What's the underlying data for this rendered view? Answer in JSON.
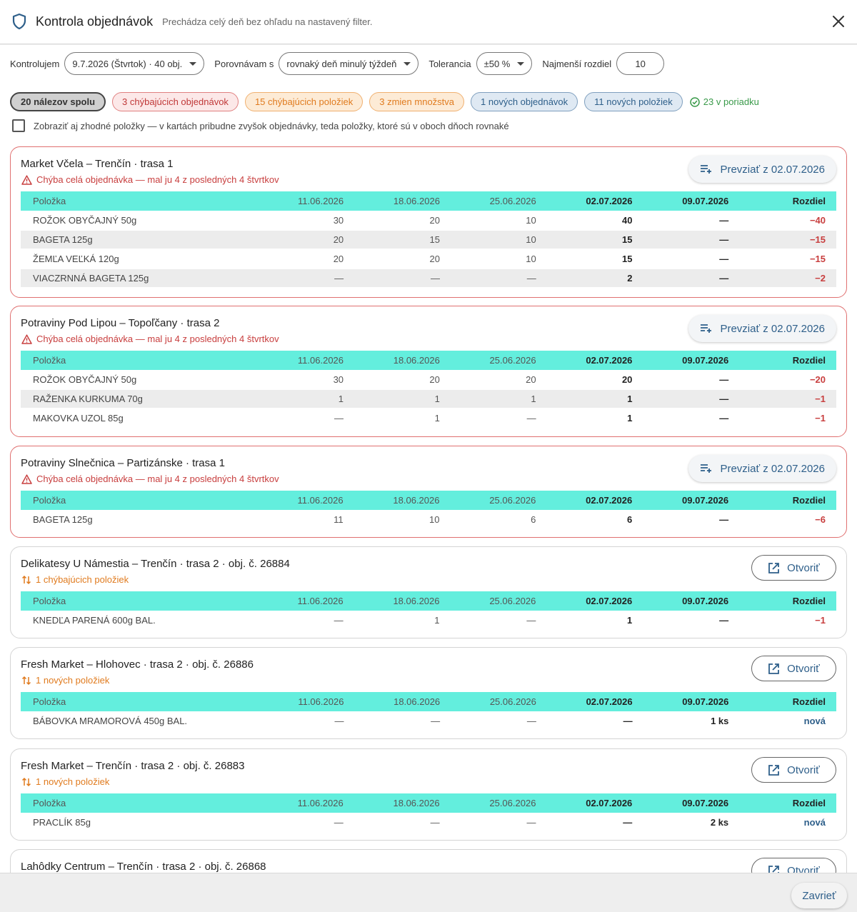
{
  "header": {
    "title": "Kontrola objednávok",
    "subtitle": "Prechádza celý deň bez ohľadu na nastavený filter."
  },
  "filters": {
    "check_label": "Kontrolujem",
    "check_value": "9.7.2026 (Štvrtok) · 40 obj.",
    "compare_label": "Porovnávam s",
    "compare_value": "rovnaký deň minulý týždeň",
    "tolerance_label": "Tolerancia",
    "tolerance_value": "±50 %",
    "min_diff_label": "Najmenší rozdiel",
    "min_diff_value": "10"
  },
  "chips": {
    "all": "20 nálezov spolu",
    "missing_orders": "3 chýbajúcich objednávok",
    "missing_items": "15 chýbajúcich položiek",
    "qty_changes": "3 zmien množstva",
    "new_orders": "1 nových objednávok",
    "new_items": "11 nových položiek",
    "ok": "23 v poriadku"
  },
  "show_matching_label": "Zobraziť aj zhodné položky — v kartách pribudne zvyšok objednávky, teda položky, ktoré sú v oboch dňoch rovnaké",
  "table_headers": [
    "Položka",
    "11.06.2026",
    "18.06.2026",
    "25.06.2026",
    "02.07.2026",
    "09.07.2026",
    "Rozdiel"
  ],
  "cards": [
    {
      "name": "Market Včela – Trenčín · trasa 1",
      "note": "Chýba celá objednávka — mal ju 4 z posledných 4 štvrtkov",
      "action": "Prevziať z 02.07.2026",
      "rows": [
        [
          "ROŽOK OBYČAJNÝ 50g",
          "30",
          "20",
          "10",
          "40",
          "—",
          "−40"
        ],
        [
          "BAGETA 125g",
          "20",
          "15",
          "10",
          "15",
          "—",
          "−15"
        ],
        [
          "ŽEMĽA VEĽKÁ 120g",
          "20",
          "20",
          "10",
          "15",
          "—",
          "−15"
        ],
        [
          "VIACZRNNÁ BAGETA 125g",
          "—",
          "—",
          "—",
          "2",
          "—",
          "−2"
        ]
      ]
    },
    {
      "name": "Potraviny Pod Lipou – Topoľčany · trasa 2",
      "note": "Chýba celá objednávka — mal ju 4 z posledných 4 štvrtkov",
      "action": "Prevziať z 02.07.2026",
      "rows": [
        [
          "ROŽOK OBYČAJNÝ 50g",
          "30",
          "20",
          "20",
          "20",
          "—",
          "−20"
        ],
        [
          "RAŽENKA KURKUMA 70g",
          "1",
          "1",
          "1",
          "1",
          "—",
          "−1"
        ],
        [
          "MAKOVKA UZOL 85g",
          "—",
          "1",
          "—",
          "1",
          "—",
          "−1"
        ]
      ]
    },
    {
      "name": "Potraviny Slnečnica – Partizánske · trasa 1",
      "note": "Chýba celá objednávka — mal ju 4 z posledných 4 štvrtkov",
      "action": "Prevziať z 02.07.2026",
      "rows": [
        [
          "BAGETA 125g",
          "11",
          "10",
          "6",
          "6",
          "—",
          "−6"
        ]
      ]
    },
    {
      "name": "Delikatesy U Námestia – Trenčín · trasa 2 · obj. č. 26884",
      "note": "1 chýbajúcich položiek",
      "action": "Otvoriť",
      "rows": [
        [
          "KNEDĽA PARENÁ 600g BAL.",
          "—",
          "1",
          "—",
          "1",
          "—",
          "−1"
        ]
      ]
    },
    {
      "name": "Fresh Market – Hlohovec · trasa 2 · obj. č. 26886",
      "note": "1 nových položiek",
      "action": "Otvoriť",
      "rows": [
        [
          "BÁBOVKA MRAMOROVÁ 450g BAL.",
          "—",
          "—",
          "—",
          "—",
          "1 ks",
          "nová"
        ]
      ]
    },
    {
      "name": "Fresh Market – Trenčín · trasa 2 · obj. č. 26883",
      "note": "1 nových položiek",
      "action": "Otvoriť",
      "rows": [
        [
          "PRACLÍK 85g",
          "—",
          "—",
          "—",
          "—",
          "2 ks",
          "nová"
        ]
      ]
    },
    {
      "name": "Lahôdky Centrum – Trenčín · trasa 2 · obj. č. 26868",
      "action": "Otvoriť"
    }
  ],
  "footer": {
    "close_label": "Zavrieť"
  },
  "colors": {
    "accent": "#2e5f8a",
    "table_header": "#63eedd",
    "error": "#c83e3e",
    "warning": "#e07b1f",
    "ok": "#3a9a4a"
  }
}
